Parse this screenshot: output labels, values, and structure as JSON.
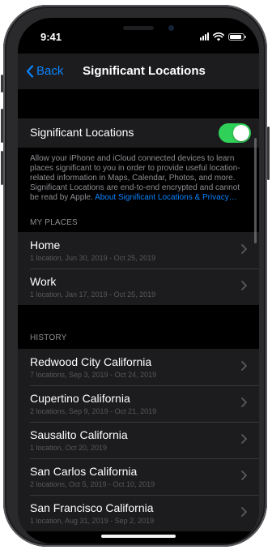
{
  "status_bar": {
    "time": "9:41"
  },
  "nav": {
    "back_label": "Back",
    "title": "Significant Locations"
  },
  "settings": {
    "toggle_label": "Significant Locations",
    "toggle_on": true,
    "description": "Allow your iPhone and iCloud connected devices to learn places significant to you in order to provide useful location-related information in Maps, Calendar, Photos, and more. Significant Locations are end-to-end encrypted and cannot be read by Apple. ",
    "link_text": "About Significant Locations & Privacy…"
  },
  "my_places": {
    "header": "MY PLACES",
    "items": [
      {
        "title": "Home",
        "subtitle": "1 location, Jun 30, 2019 - Oct 25, 2019"
      },
      {
        "title": "Work",
        "subtitle": "1 location, Jan 17, 2019 - Oct 25, 2019"
      }
    ]
  },
  "history": {
    "header": "HISTORY",
    "items": [
      {
        "title": "Redwood City California",
        "subtitle": "7 locations, Sep 3, 2019 - Oct 24, 2019"
      },
      {
        "title": "Cupertino California",
        "subtitle": "2 locations, Sep 9, 2019 - Oct 21, 2019"
      },
      {
        "title": "Sausalito California",
        "subtitle": "1 location, Oct 20, 2019"
      },
      {
        "title": "San Carlos California",
        "subtitle": "2 locations, Oct 5, 2019 - Oct 10, 2019"
      },
      {
        "title": "San Francisco California",
        "subtitle": "1 location, Aug 31, 2019 - Sep 2, 2019"
      }
    ]
  },
  "colors": {
    "accent": "#0a84ff",
    "toggle_on": "#30d158",
    "cell_bg": "#1c1c1e",
    "secondary_text": "#8e8e93"
  },
  "icons": {
    "back": "chevron-left-icon",
    "row": "chevron-right-icon"
  }
}
